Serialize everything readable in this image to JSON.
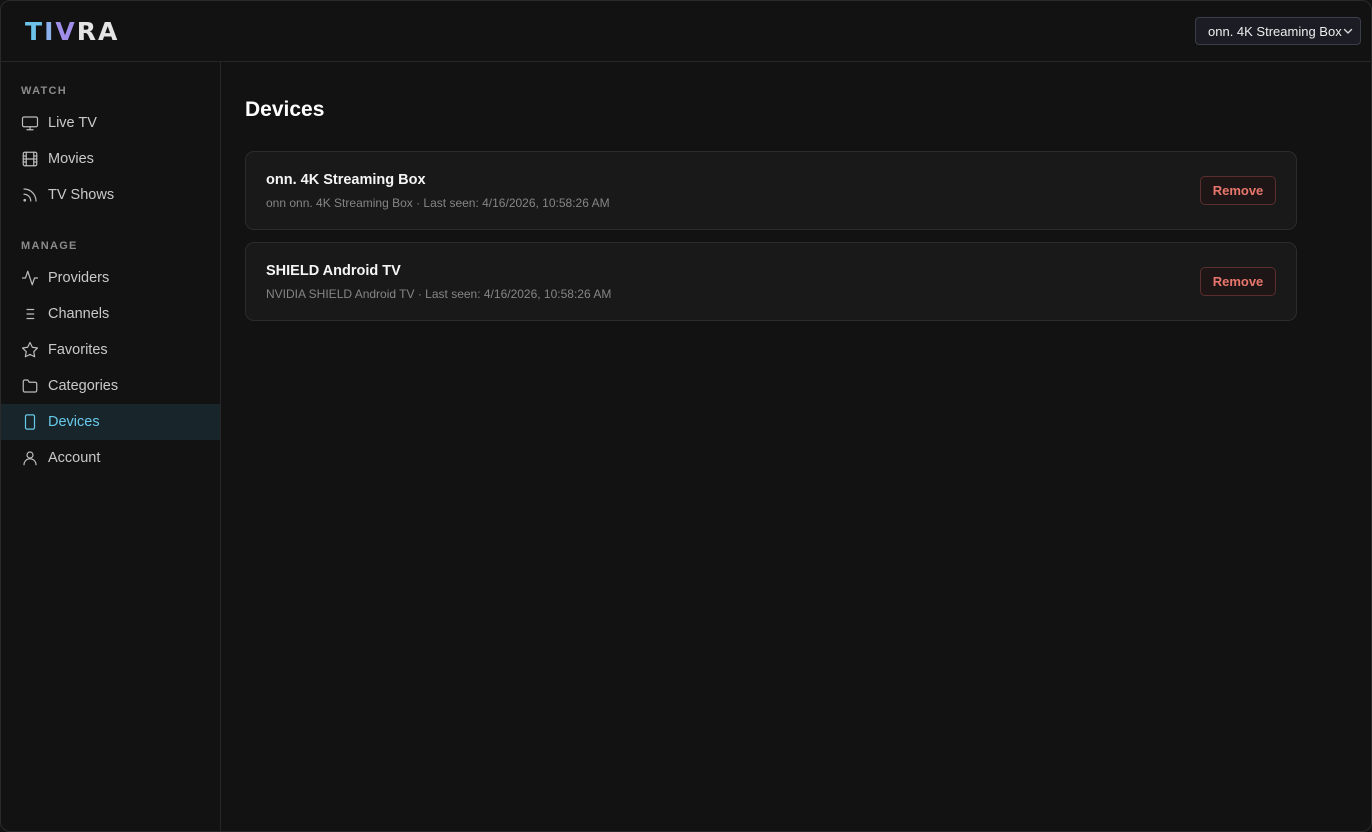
{
  "brand": {
    "letters": [
      "T",
      "I",
      "V",
      "R",
      "A"
    ]
  },
  "header": {
    "device_selector": {
      "value": "onn. 4K Streaming Box"
    }
  },
  "sidebar": {
    "watch_label": "WATCH",
    "watch_items": [
      {
        "label": "Live TV",
        "icon": "tv-icon"
      },
      {
        "label": "Movies",
        "icon": "film-icon"
      },
      {
        "label": "TV Shows",
        "icon": "rss-icon"
      }
    ],
    "manage_label": "MANAGE",
    "manage_items": [
      {
        "label": "Providers",
        "icon": "activity-icon"
      },
      {
        "label": "Channels",
        "icon": "list-icon"
      },
      {
        "label": "Favorites",
        "icon": "star-icon"
      },
      {
        "label": "Categories",
        "icon": "folder-icon"
      },
      {
        "label": "Devices",
        "icon": "tablet-icon",
        "active": true
      },
      {
        "label": "Account",
        "icon": "user-icon"
      }
    ]
  },
  "main": {
    "title": "Devices",
    "devices": [
      {
        "name": "onn. 4K Streaming Box",
        "meta": "onn onn. 4K Streaming Box · Last seen: 4/16/2026, 10:58:26 AM",
        "remove_label": "Remove"
      },
      {
        "name": "SHIELD Android TV",
        "meta": "NVIDIA SHIELD Android TV · Last seen: 4/16/2026, 10:58:26 AM",
        "remove_label": "Remove"
      }
    ]
  },
  "colors": {
    "accent": "#67c9ea",
    "danger": "#e8766c",
    "background": "#121212"
  }
}
